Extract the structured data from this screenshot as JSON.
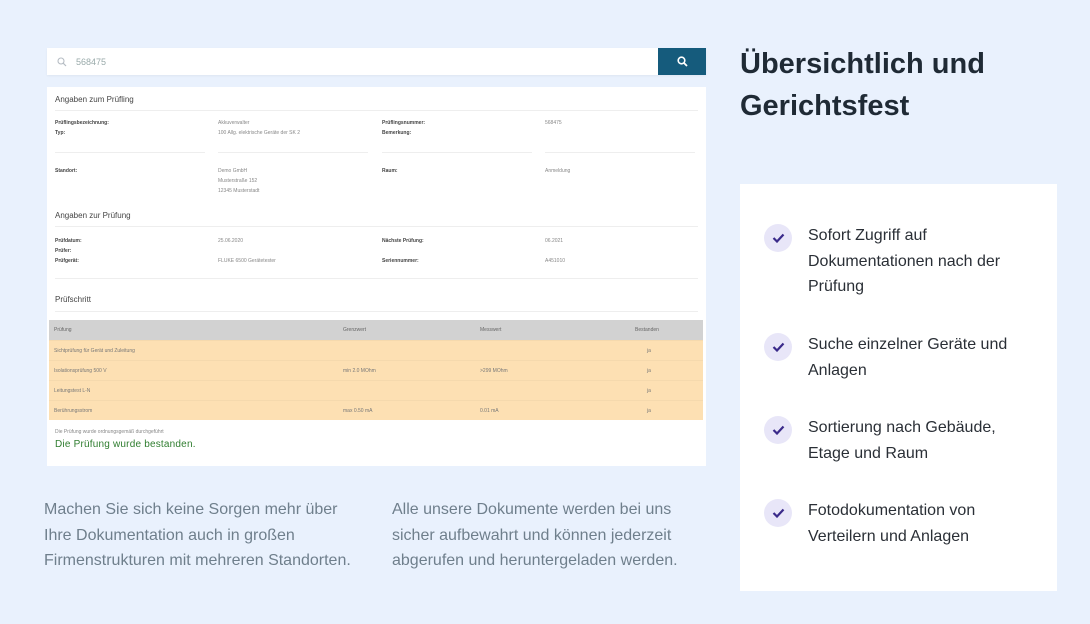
{
  "search": {
    "value": "568475"
  },
  "card": {
    "section1_title": "Angaben zum Prüfling",
    "fields1": [
      {
        "label": "Prüflingsbezeichnung:",
        "value": "Akkuverwalter"
      },
      {
        "label": "Typ:",
        "value": "100 Allg. elektrische Geräte der SK 2"
      },
      {
        "label": "Prüflingsnummer:",
        "value": "568475"
      },
      {
        "label": "Bemerkung:",
        "value": ""
      },
      {
        "label": "Standort:",
        "value_lines": [
          "Demo GmbH",
          "Musterstraße 152",
          "12345 Musterstadt"
        ]
      },
      {
        "label": "Raum:",
        "value": "Anmeldung"
      }
    ],
    "section2_title": "Angaben zur Prüfung",
    "fields2": [
      {
        "label": "Prüfdatum:",
        "value": "25.06.2020"
      },
      {
        "label": "Prüfer:",
        "value": ""
      },
      {
        "label": "Prüfgerät:",
        "value": "FLUKE 6500 Gerätetester"
      },
      {
        "label": "Nächste Prüfung:",
        "value": "06.2021"
      },
      {
        "label": "Seriennummer:",
        "value": "A451010"
      }
    ],
    "section3_title": "Prüfschritt",
    "table": {
      "headers": [
        "Prüfung",
        "Grenzwert",
        "Messwert",
        "Bestanden"
      ],
      "rows": [
        [
          "Sichtprüfung für Gerät und Zuleitung",
          "",
          "",
          "ja"
        ],
        [
          "Isolationsprüfung 500 V",
          "min 2.0 MOhm",
          ">299 MOhm",
          "ja"
        ],
        [
          "Leitungstest L-N",
          "",
          "",
          "ja"
        ],
        [
          "Berührungsstrom",
          "max 0.50 mA",
          "0.01 mA",
          "ja"
        ]
      ]
    },
    "note": "Die Prüfung wurde ordnungsgemäß durchgeführt",
    "passed": "Die Prüfung wurde bestanden."
  },
  "heading": {
    "line1": "Übersichtlich und",
    "line2": "Gerichtsfest"
  },
  "features": [
    "Sofort Zugriff auf Dokumentationen nach der Prüfung",
    "Suche einzelner Geräte und Anlagen",
    "Sortierung nach Gebäude, Etage und Raum",
    "Fotodokumentation von Verteilern und Anlagen"
  ],
  "bottom": {
    "left": "Machen Sie sich keine Sorgen mehr über Ihre Dokumentation auch in großen Firmenstrukturen mit mehreren Standorten.",
    "right": "Alle unsere Dokumente werden bei uns sicher aufbewahrt und können jederzeit abgerufen und heruntergeladen werden."
  },
  "colors": {
    "background": "#e9f1fd",
    "search_button": "#155b7c",
    "table_row": "#fde0b3",
    "table_head": "#d2d2d2",
    "passed_text": "#2f7d2f",
    "check_bg": "#e8e6f8",
    "check_mark": "#3a2a8a"
  },
  "icons": {
    "search_field": "search-icon",
    "search_button": "search-icon",
    "feature_bullet": "check-icon"
  }
}
